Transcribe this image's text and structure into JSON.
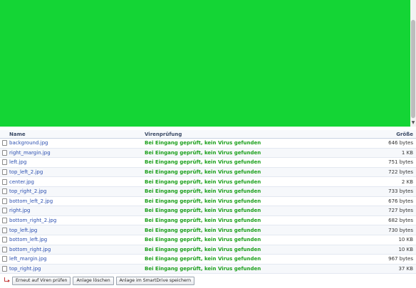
{
  "table": {
    "headers": {
      "name": "Name",
      "scan": "Virenprüfung",
      "size": "Größe"
    },
    "rows": [
      {
        "name": "background.jpg",
        "scan": "Bei Eingang geprüft, kein Virus gefunden",
        "size": "646 bytes"
      },
      {
        "name": "right_margin.jpg",
        "scan": "Bei Eingang geprüft, kein Virus gefunden",
        "size": "1 KB"
      },
      {
        "name": "left.jpg",
        "scan": "Bei Eingang geprüft, kein Virus gefunden",
        "size": "751 bytes"
      },
      {
        "name": "top_left_2.jpg",
        "scan": "Bei Eingang geprüft, kein Virus gefunden",
        "size": "722 bytes"
      },
      {
        "name": "center.jpg",
        "scan": "Bei Eingang geprüft, kein Virus gefunden",
        "size": "2 KB"
      },
      {
        "name": "top_right_2.jpg",
        "scan": "Bei Eingang geprüft, kein Virus gefunden",
        "size": "733 bytes"
      },
      {
        "name": "bottom_left_2.jpg",
        "scan": "Bei Eingang geprüft, kein Virus gefunden",
        "size": "676 bytes"
      },
      {
        "name": "right.jpg",
        "scan": "Bei Eingang geprüft, kein Virus gefunden",
        "size": "727 bytes"
      },
      {
        "name": "bottom_right_2.jpg",
        "scan": "Bei Eingang geprüft, kein Virus gefunden",
        "size": "682 bytes"
      },
      {
        "name": "top_left.jpg",
        "scan": "Bei Eingang geprüft, kein Virus gefunden",
        "size": "730 bytes"
      },
      {
        "name": "bottom_left.jpg",
        "scan": "Bei Eingang geprüft, kein Virus gefunden",
        "size": "10 KB"
      },
      {
        "name": "bottom_right.jpg",
        "scan": "Bei Eingang geprüft, kein Virus gefunden",
        "size": "10 KB"
      },
      {
        "name": "left_margin.jpg",
        "scan": "Bei Eingang geprüft, kein Virus gefunden",
        "size": "967 bytes"
      },
      {
        "name": "top_right.jpg",
        "scan": "Bei Eingang geprüft, kein Virus gefunden",
        "size": "37 KB"
      }
    ]
  },
  "actions": {
    "rescan_label": "Erneut auf Viren prüfen",
    "delete_label": "Anlage löschen",
    "save_smartdrive_label": "Anlage im SmartDrive speichern"
  },
  "colors": {
    "preview": "#14d535",
    "link": "#2b4fb0",
    "status_ok": "#1da01d"
  },
  "icons": {
    "scroll_down": "▼",
    "return_arrow": "return-arrow-icon",
    "checkbox": "checkbox"
  }
}
